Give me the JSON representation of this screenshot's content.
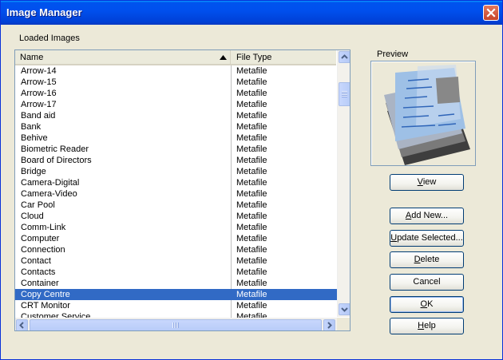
{
  "window": {
    "title": "Image Manager"
  },
  "loaded_images_label": "Loaded Images",
  "preview_label": "Preview",
  "columns": {
    "name": "Name",
    "file_type": "File Type"
  },
  "rows": [
    {
      "name": "Arrow-14",
      "type": "Metafile"
    },
    {
      "name": "Arrow-15",
      "type": "Metafile"
    },
    {
      "name": "Arrow-16",
      "type": "Metafile"
    },
    {
      "name": "Arrow-17",
      "type": "Metafile"
    },
    {
      "name": "Band aid",
      "type": "Metafile"
    },
    {
      "name": "Bank",
      "type": "Metafile"
    },
    {
      "name": "Behive",
      "type": "Metafile"
    },
    {
      "name": "Biometric Reader",
      "type": "Metafile"
    },
    {
      "name": "Board of Directors",
      "type": "Metafile"
    },
    {
      "name": "Bridge",
      "type": "Metafile"
    },
    {
      "name": "Camera-Digital",
      "type": "Metafile"
    },
    {
      "name": "Camera-Video",
      "type": "Metafile"
    },
    {
      "name": "Car Pool",
      "type": "Metafile"
    },
    {
      "name": "Cloud",
      "type": "Metafile"
    },
    {
      "name": "Comm-Link",
      "type": "Metafile"
    },
    {
      "name": "Computer",
      "type": "Metafile"
    },
    {
      "name": "Connection",
      "type": "Metafile"
    },
    {
      "name": "Contact",
      "type": "Metafile"
    },
    {
      "name": "Contacts",
      "type": "Metafile"
    },
    {
      "name": "Container",
      "type": "Metafile"
    },
    {
      "name": "Copy Centre",
      "type": "Metafile",
      "selected": true
    },
    {
      "name": "CRT Monitor",
      "type": "Metafile"
    },
    {
      "name": "Customer Service",
      "type": "Metafile"
    }
  ],
  "buttons": {
    "view": {
      "pre": "",
      "u": "V",
      "post": "iew"
    },
    "add_new": {
      "pre": "",
      "u": "A",
      "post": "dd New..."
    },
    "update_selected": {
      "pre": "",
      "u": "U",
      "post": "pdate Selected..."
    },
    "delete": {
      "pre": "",
      "u": "D",
      "post": "elete"
    },
    "cancel": {
      "pre": "Cancel",
      "u": "",
      "post": ""
    },
    "ok": {
      "pre": "",
      "u": "O",
      "post": "K"
    },
    "help": {
      "pre": "",
      "u": "H",
      "post": "elp"
    }
  },
  "colors": {
    "title_bar": "#0053ee",
    "selection": "#316ac5",
    "dialog_bg": "#ece9d8"
  },
  "icons": [
    "close-icon",
    "sort-ascending-icon",
    "scroll-up-icon",
    "scroll-down-icon",
    "scroll-left-icon",
    "scroll-right-icon",
    "document-stack-preview"
  ]
}
